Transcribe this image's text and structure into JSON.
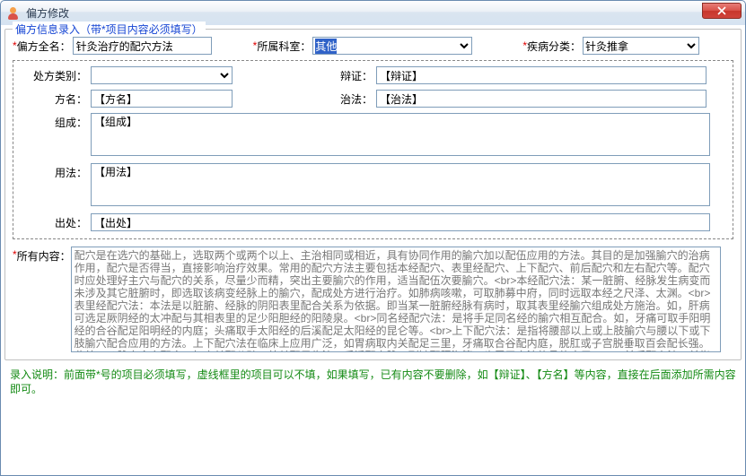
{
  "window": {
    "title": "偏方修改"
  },
  "group": {
    "legend": "偏方信息录入（带*项目内容必须填写）"
  },
  "top": {
    "name_label": "偏方全名：",
    "name_value": "针灸治疗的配穴方法",
    "dept_label": "所属科室：",
    "dept_value": "其他",
    "category_label": "疾病分类：",
    "category_value": "针灸推拿"
  },
  "mid": {
    "type_label": "处方类别：",
    "type_value": "",
    "bianzheng_label": "辩证：",
    "bianzheng_value": "【辩证】",
    "fangming_label": "方名：",
    "fangming_value": "【方名】",
    "zhifa_label": "治法：",
    "zhifa_value": "【治法】",
    "zucheng_label": "组成：",
    "zucheng_value": "【组成】",
    "yongfa_label": "用法：",
    "yongfa_value": "【用法】",
    "chuchu_label": "出处：",
    "chuchu_value": "【出处】"
  },
  "all": {
    "label": "所有内容：",
    "value": "配穴是在选穴的基础上，选取两个或两个以上、主治相同或相近，具有协同作用的腧穴加以配伍应用的方法。其目的是加强腧穴的治病作用，配穴是否得当，直接影响治疗效果。常用的配穴方法主要包括本经配穴、表里经配穴、上下配穴、前后配穴和左右配穴等。配穴时应处理好主穴与配穴的关系，尽量少而精，突出主要腧穴的作用，适当配伍次要腧穴。<br>本经配穴法：某一脏腑、经脉发生病变而未涉及其它脏腑时，即选取该病变经脉上的腧穴，配成处方进行治疗。如肺病咳嗽，可取肺募中府，同时远取本经之尺泽、太渊。<br>表里经配穴法：本法是以脏腑、经脉的阴阳表里配合关系为依据。即当某一脏腑经脉有病时，取其表里经腧穴组成处方施治。如，肝病可选足厥阴经的太冲配与其相表里的足少阳胆经的阳陵泉。<br>同名经配穴法：是将手足同名经的腧穴相互配合。如，牙痛可取手阳明经的合谷配足阳明经的内庭；头痛取手太阳经的后溪配足太阳经的昆仑等。<br>上下配穴法：是指将腰部以上或上肢腧穴与腰以下或下肢腧穴配合应用的方法。上下配穴法在临床上应用广泛，如胃病取内关配足三里，牙痛取合谷配内庭，脱肛或子宫脱垂取百会配长强。此外，八脉交会穴配合，如内关配公孙，外关配足临泣，后溪配申脉，列缺配照海等，也属于本法的具体应用。<br>前后配穴法：前指胸腹，"
  },
  "footer": {
    "text": "录入说明：前面带*号的项目必须填写，虚线框里的项目可以不填，如果填写，已有内容不要删除，如【辩证】、【方名】等内容，直接在后面添加所需内容即可。"
  }
}
